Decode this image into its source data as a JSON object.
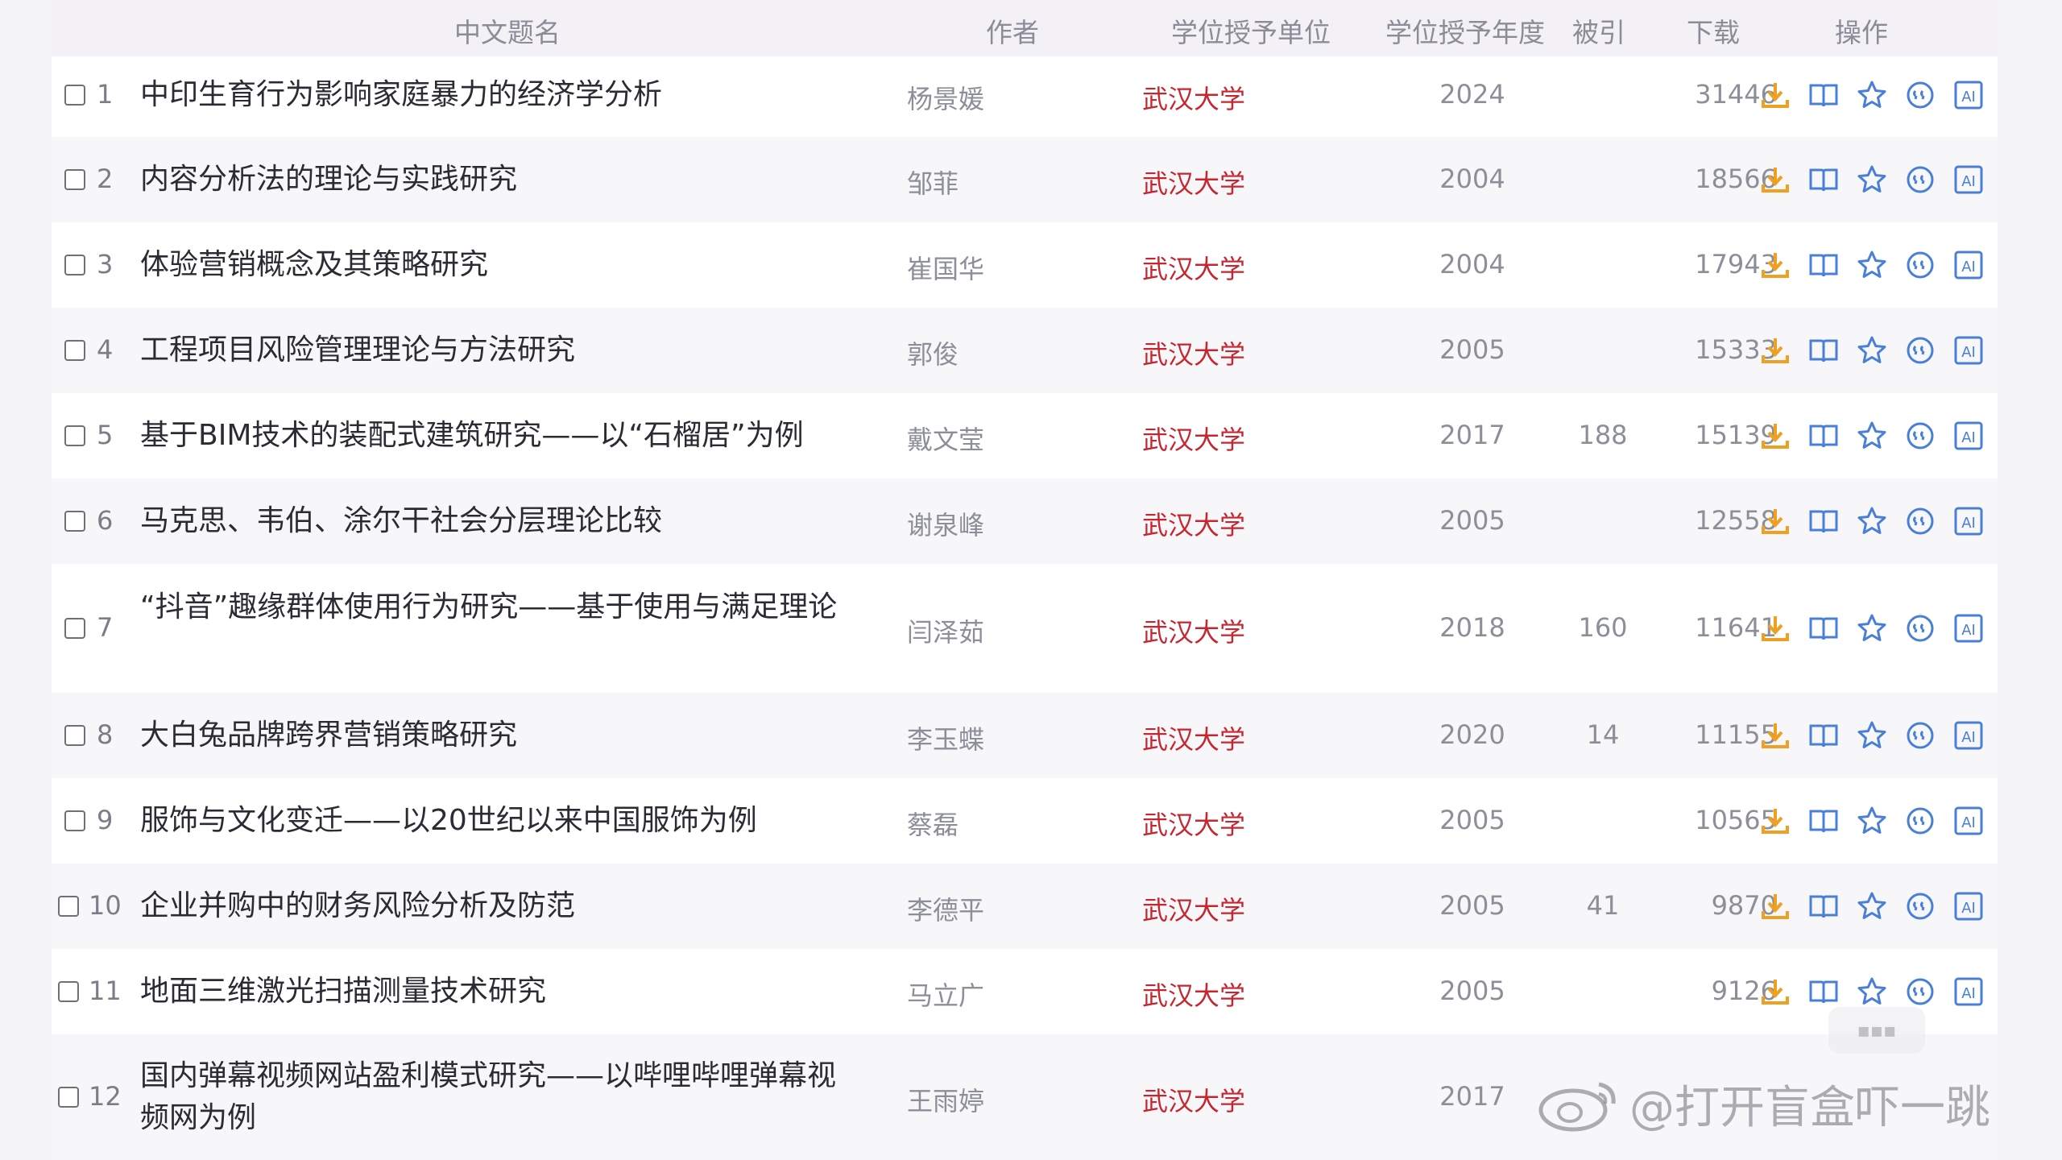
{
  "header": {
    "title": "中文题名",
    "author": "作者",
    "school": "学位授予单位",
    "year": "学位授予年度",
    "cited": "被引",
    "downloads": "下载",
    "actions": "操作"
  },
  "rows": [
    {
      "index": "1",
      "title": "中印生育行为影响家庭暴力的经济学分析",
      "author": "杨景媛",
      "school": "武汉大学",
      "year": "2024",
      "cited": "",
      "downloads": "31446"
    },
    {
      "index": "2",
      "title": "内容分析法的理论与实践研究",
      "author": "邹菲",
      "school": "武汉大学",
      "year": "2004",
      "cited": "",
      "downloads": "18566"
    },
    {
      "index": "3",
      "title": "体验营销概念及其策略研究",
      "author": "崔国华",
      "school": "武汉大学",
      "year": "2004",
      "cited": "",
      "downloads": "17943"
    },
    {
      "index": "4",
      "title": "工程项目风险管理理论与方法研究",
      "author": "郭俊",
      "school": "武汉大学",
      "year": "2005",
      "cited": "",
      "downloads": "15333"
    },
    {
      "index": "5",
      "title": "基于BIM技术的装配式建筑研究——以“石榴居”为例",
      "author": "戴文莹",
      "school": "武汉大学",
      "year": "2017",
      "cited": "188",
      "downloads": "15139"
    },
    {
      "index": "6",
      "title": "马克思、韦伯、涂尔干社会分层理论比较",
      "author": "谢泉峰",
      "school": "武汉大学",
      "year": "2005",
      "cited": "",
      "downloads": "12558"
    },
    {
      "index": "7",
      "title": "“抖音”趣缘群体使用行为研究——基于使用与满足理论",
      "author": "闫泽茹",
      "school": "武汉大学",
      "year": "2018",
      "cited": "160",
      "downloads": "11641"
    },
    {
      "index": "8",
      "title": "大白兔品牌跨界营销策略研究",
      "author": "李玉蝶",
      "school": "武汉大学",
      "year": "2020",
      "cited": "14",
      "downloads": "11155"
    },
    {
      "index": "9",
      "title": "服饰与文化变迁——以20世纪以来中国服饰为例",
      "author": "蔡磊",
      "school": "武汉大学",
      "year": "2005",
      "cited": "",
      "downloads": "10565"
    },
    {
      "index": "10",
      "title": "企业并购中的财务风险分析及防范",
      "author": "李德平",
      "school": "武汉大学",
      "year": "2005",
      "cited": "41",
      "downloads": "9870"
    },
    {
      "index": "11",
      "title": "地面三维激光扫描测量技术研究",
      "author": "马立广",
      "school": "武汉大学",
      "year": "2005",
      "cited": "",
      "downloads": "9126"
    },
    {
      "index": "12",
      "title": "国内弹幕视频网站盈利模式研究——以哔哩哔哩弹幕视频网为例",
      "author": "王雨婷",
      "school": "武汉大学",
      "year": "2017",
      "cited": "",
      "downloads": ""
    }
  ],
  "action_icons": [
    "download-icon",
    "read-book-icon",
    "favorite-star-icon",
    "quote-icon",
    "ai-icon"
  ],
  "colors": {
    "school": "#c5262f",
    "download_icon": "#f0a020",
    "action_icon": "#4a7fd8",
    "header_bg": "#f4f1f6"
  },
  "watermark": {
    "text": "@打开盲盒吓一跳"
  }
}
